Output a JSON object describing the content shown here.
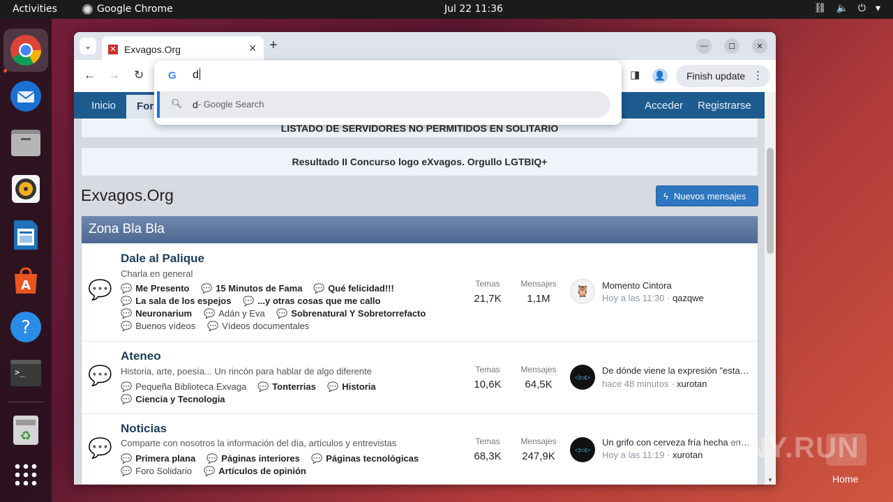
{
  "topbar": {
    "activities": "Activities",
    "app_name": "Google Chrome",
    "clock": "Jul 22  11:36",
    "tray_icons": [
      "network-icon",
      "volume-icon",
      "power-icon",
      "menu-arrow-icon"
    ]
  },
  "dock": {
    "items": [
      "chrome-icon",
      "thunderbird-icon",
      "files-icon",
      "rhythmbox-icon",
      "writer-icon",
      "app-center-icon",
      "help-icon",
      "terminal-icon",
      "trash-icon",
      "apps-grid-icon"
    ]
  },
  "browser": {
    "tab_title": "Exvagos.Org",
    "finish_update": "Finish update",
    "omnibox": {
      "input": "d",
      "suggestion_query": "d",
      "suggestion_suffix": " - Google Search"
    }
  },
  "site": {
    "nav": {
      "inicio": "Inicio",
      "foros_partial": "For",
      "acceder": "Acceder",
      "registrarse": "Registrarse"
    },
    "notice1": "LISTADO DE SERVIDORES NO PERMITIDOS EN SOLITARIO",
    "notice2": "Resultado II Concurso logo eXvagos. Orgullo LGTBIQ+",
    "forum_title": "Exvagos.Org",
    "new_messages": "Nuevos mensajes",
    "section_title": "Zona Bla Bla",
    "nodes": [
      {
        "title": "Dale al Palique",
        "desc": "Charla en general",
        "subforums": [
          "Me Presento",
          "15 Minutos de Fama",
          "Qué felicidad!!!",
          "La sala de los espejos",
          "...y otras cosas que me callo",
          "Neuronarium",
          "Adán y Eva",
          "Sobrenatural Y Sobretorrefacto",
          "Buenos vídeos",
          "Vídeos documentales"
        ],
        "temas_label": "Temas",
        "temas": "21,7K",
        "mensajes_label": "Mensajes",
        "mensajes": "1,1M",
        "last_title": "Momento Cintora",
        "last_time": "Hoy a las 11:30",
        "last_sep": " · ",
        "last_user": "qazqwe"
      },
      {
        "title": "Ateneo",
        "desc": "Historia, arte, poesía... Un rincón para hablar de algo diferente",
        "subforums": [
          "Pequeña Biblioteca Exvaga",
          "Tonterrias",
          "Historia",
          "Ciencia y Tecnologia"
        ],
        "temas_label": "Temas",
        "temas": "10,6K",
        "mensajes_label": "Mensajes",
        "mensajes": "64,5K",
        "last_title": "De dónde viene la expresión \"esta…",
        "last_time": "hace 48 minutos",
        "last_sep": " · ",
        "last_user": "xurotan"
      },
      {
        "title": "Noticias",
        "desc": "Comparte con nosotros la información del día, artículos y entrevistas",
        "subforums": [
          "Primera plana",
          "Páginas interiores",
          "Páginas tecnológicas",
          "Foro Solidario",
          "Artículos de opinión"
        ],
        "temas_label": "Temas",
        "temas": "68,3K",
        "mensajes_label": "Mensajes",
        "mensajes": "247,9K",
        "last_title": "Un grifo con cerveza fría hecha en…",
        "last_time": "Hoy a las 11:19",
        "last_sep": " · ",
        "last_user": "xurotan"
      }
    ]
  },
  "desktop": {
    "watermark": "ANY.RUN",
    "home_label": "Home"
  }
}
